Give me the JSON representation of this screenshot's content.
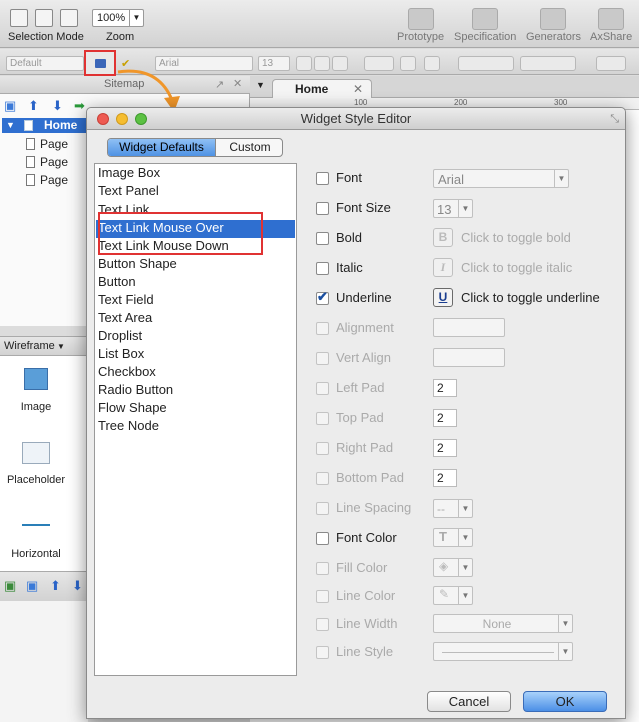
{
  "toolbar": {
    "selection_mode_label": "Selection Mode",
    "zoom_value": "100%",
    "zoom_label": "Zoom",
    "prototype_label": "Prototype",
    "specification_label": "Specification",
    "generators_label": "Generators",
    "axshare_label": "AxShare"
  },
  "format_bar": {
    "style_value": "Default",
    "font_value": "Arial",
    "size_value": "13"
  },
  "sitemap": {
    "title": "Sitemap",
    "home_label": "Home",
    "pages": [
      "Page",
      "Page",
      "Page"
    ]
  },
  "wireframe": {
    "title": "Wireframe",
    "widgets": [
      "Image",
      "Placeholder",
      "Horizontal"
    ]
  },
  "canvas": {
    "tab_label": "Home",
    "ruler_ticks": [
      "100",
      "200",
      "300"
    ]
  },
  "dialog": {
    "title": "Widget Style Editor",
    "tabs": [
      "Widget Defaults",
      "Custom"
    ],
    "widget_list": [
      "Image Box",
      "Text Panel",
      "Text Link",
      "Text Link Mouse Over",
      "Text Link Mouse Down",
      "Button Shape",
      "Button",
      "Text Field",
      "Text Area",
      "Droplist",
      "List Box",
      "Checkbox",
      "Radio Button",
      "Flow Shape",
      "Tree Node"
    ],
    "selected_widget": "Text Link Mouse Over",
    "properties": {
      "font": {
        "label": "Font",
        "value": "Arial"
      },
      "font_size": {
        "label": "Font Size",
        "value": "13"
      },
      "bold": {
        "label": "Bold",
        "hint": "Click to toggle bold"
      },
      "italic": {
        "label": "Italic",
        "hint": "Click to toggle italic"
      },
      "underline": {
        "label": "Underline",
        "hint": "Click to toggle underline",
        "checked": true
      },
      "alignment": {
        "label": "Alignment"
      },
      "vert_align": {
        "label": "Vert Align"
      },
      "left_pad": {
        "label": "Left Pad",
        "value": "2"
      },
      "top_pad": {
        "label": "Top Pad",
        "value": "2"
      },
      "right_pad": {
        "label": "Right Pad",
        "value": "2"
      },
      "bottom_pad": {
        "label": "Bottom Pad",
        "value": "2"
      },
      "line_spacing": {
        "label": "Line Spacing",
        "value": "--"
      },
      "font_color": {
        "label": "Font Color"
      },
      "fill_color": {
        "label": "Fill Color"
      },
      "line_color": {
        "label": "Line Color"
      },
      "line_width": {
        "label": "Line Width",
        "value": "None"
      },
      "line_style": {
        "label": "Line Style"
      }
    },
    "cancel_label": "Cancel",
    "ok_label": "OK"
  },
  "colors": {
    "selection_blue": "#2f6fd0",
    "highlight_red": "#e03232",
    "arrow_orange": "#f0962a"
  }
}
